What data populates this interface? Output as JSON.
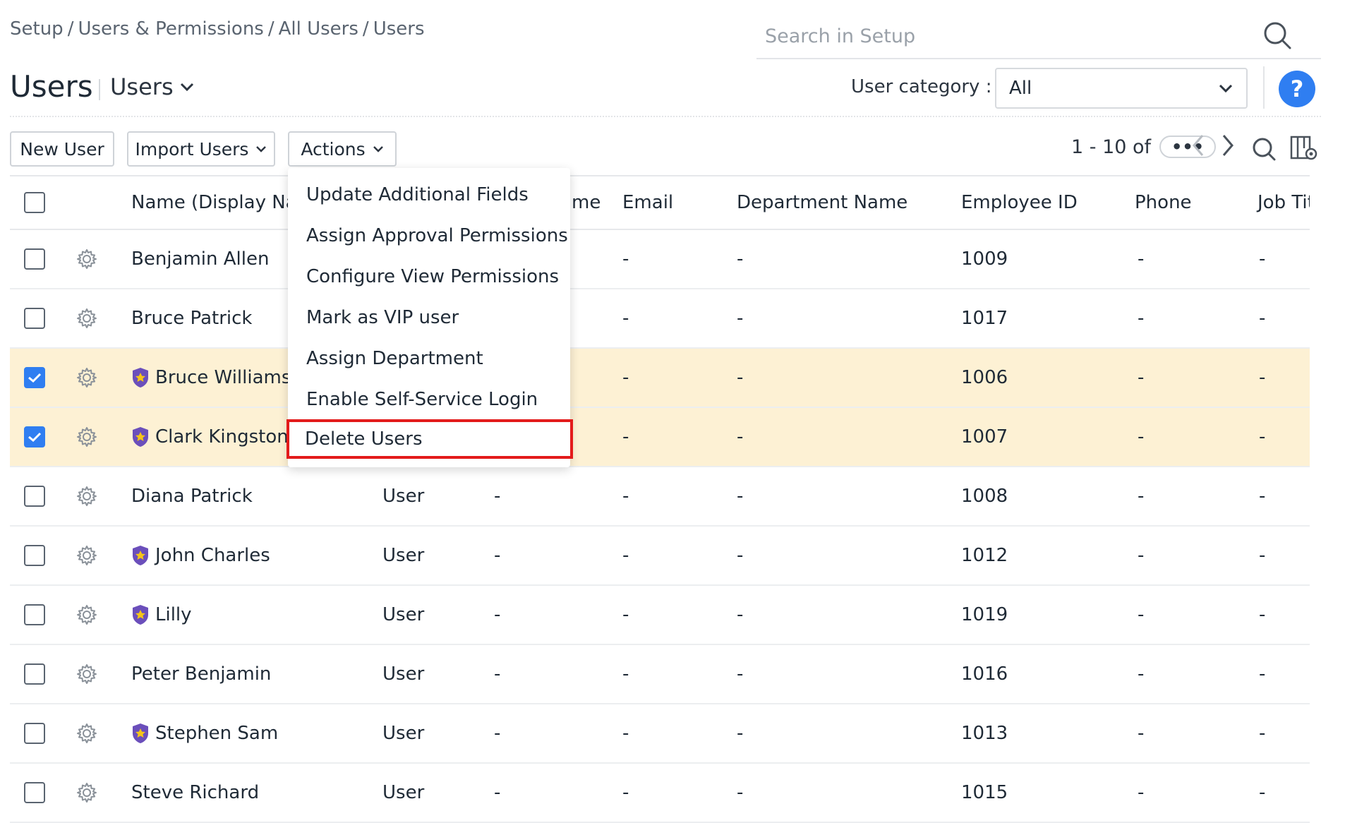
{
  "breadcrumb": [
    "Setup",
    "Users & Permissions",
    "All Users",
    "Users"
  ],
  "breadcrumb_sep": "/",
  "search": {
    "placeholder": "Search in Setup"
  },
  "page": {
    "title": "Users",
    "view_label": "Users"
  },
  "user_category": {
    "label": "User category :",
    "value": "All"
  },
  "help_label": "?",
  "toolbar": {
    "new_user": "New User",
    "import_users": "Import Users",
    "actions": "Actions"
  },
  "pagination": {
    "range": "1 - 10 of",
    "more": "•••"
  },
  "table": {
    "headers": {
      "name": "Name (Display Nan",
      "role_tail": "me",
      "email": "Email",
      "department": "Department Name",
      "employee_id": "Employee ID",
      "phone": "Phone",
      "job_title": "Job Tit"
    },
    "rows": [
      {
        "name": "Benjamin Allen",
        "vip": false,
        "checked": false,
        "role": "",
        "col3": "",
        "email": "-",
        "department": "-",
        "employee_id": "1009",
        "phone": "-",
        "job_title": "-"
      },
      {
        "name": "Bruce Patrick",
        "vip": false,
        "checked": false,
        "role": "",
        "col3": "",
        "email": "-",
        "department": "-",
        "employee_id": "1017",
        "phone": "-",
        "job_title": "-"
      },
      {
        "name": "Bruce Williams",
        "vip": true,
        "checked": true,
        "role": "",
        "col3": "",
        "email": "-",
        "department": "-",
        "employee_id": "1006",
        "phone": "-",
        "job_title": "-"
      },
      {
        "name": "Clark Kingston",
        "vip": true,
        "checked": true,
        "role": "",
        "col3": "",
        "email": "-",
        "department": "-",
        "employee_id": "1007",
        "phone": "-",
        "job_title": "-"
      },
      {
        "name": "Diana Patrick",
        "vip": false,
        "checked": false,
        "role": "User",
        "col3": "-",
        "email": "-",
        "department": "-",
        "employee_id": "1008",
        "phone": "-",
        "job_title": "-"
      },
      {
        "name": "John Charles",
        "vip": true,
        "checked": false,
        "role": "User",
        "col3": "-",
        "email": "-",
        "department": "-",
        "employee_id": "1012",
        "phone": "-",
        "job_title": "-"
      },
      {
        "name": "Lilly",
        "vip": true,
        "checked": false,
        "role": "User",
        "col3": "-",
        "email": "-",
        "department": "-",
        "employee_id": "1019",
        "phone": "-",
        "job_title": "-"
      },
      {
        "name": "Peter Benjamin",
        "vip": false,
        "checked": false,
        "role": "User",
        "col3": "-",
        "email": "-",
        "department": "-",
        "employee_id": "1016",
        "phone": "-",
        "job_title": "-"
      },
      {
        "name": "Stephen Sam",
        "vip": true,
        "checked": false,
        "role": "User",
        "col3": "-",
        "email": "-",
        "department": "-",
        "employee_id": "1013",
        "phone": "-",
        "job_title": "-"
      },
      {
        "name": "Steve Richard",
        "vip": false,
        "checked": false,
        "role": "User",
        "col3": "-",
        "email": "-",
        "department": "-",
        "employee_id": "1015",
        "phone": "-",
        "job_title": "-"
      }
    ]
  },
  "actions_menu": {
    "items": [
      "Update Additional Fields",
      "Assign Approval Permissions",
      "Configure View Permissions",
      "Mark as VIP user",
      "Assign Department",
      "Enable Self-Service Login",
      "Delete Users"
    ],
    "highlighted": "Delete Users"
  },
  "colors": {
    "accent": "#2f7ef1",
    "selected_row": "#fdf1d4",
    "highlight_border": "#e31b1b",
    "vip_badge": "#6b4fbb",
    "vip_star": "#f5c518"
  },
  "icons": [
    "search-icon",
    "chevron-down-icon",
    "help-icon",
    "more-icon",
    "chevron-left-icon",
    "chevron-right-icon",
    "column-settings-icon",
    "gear-icon",
    "vip-badge-icon",
    "checkmark-icon"
  ]
}
